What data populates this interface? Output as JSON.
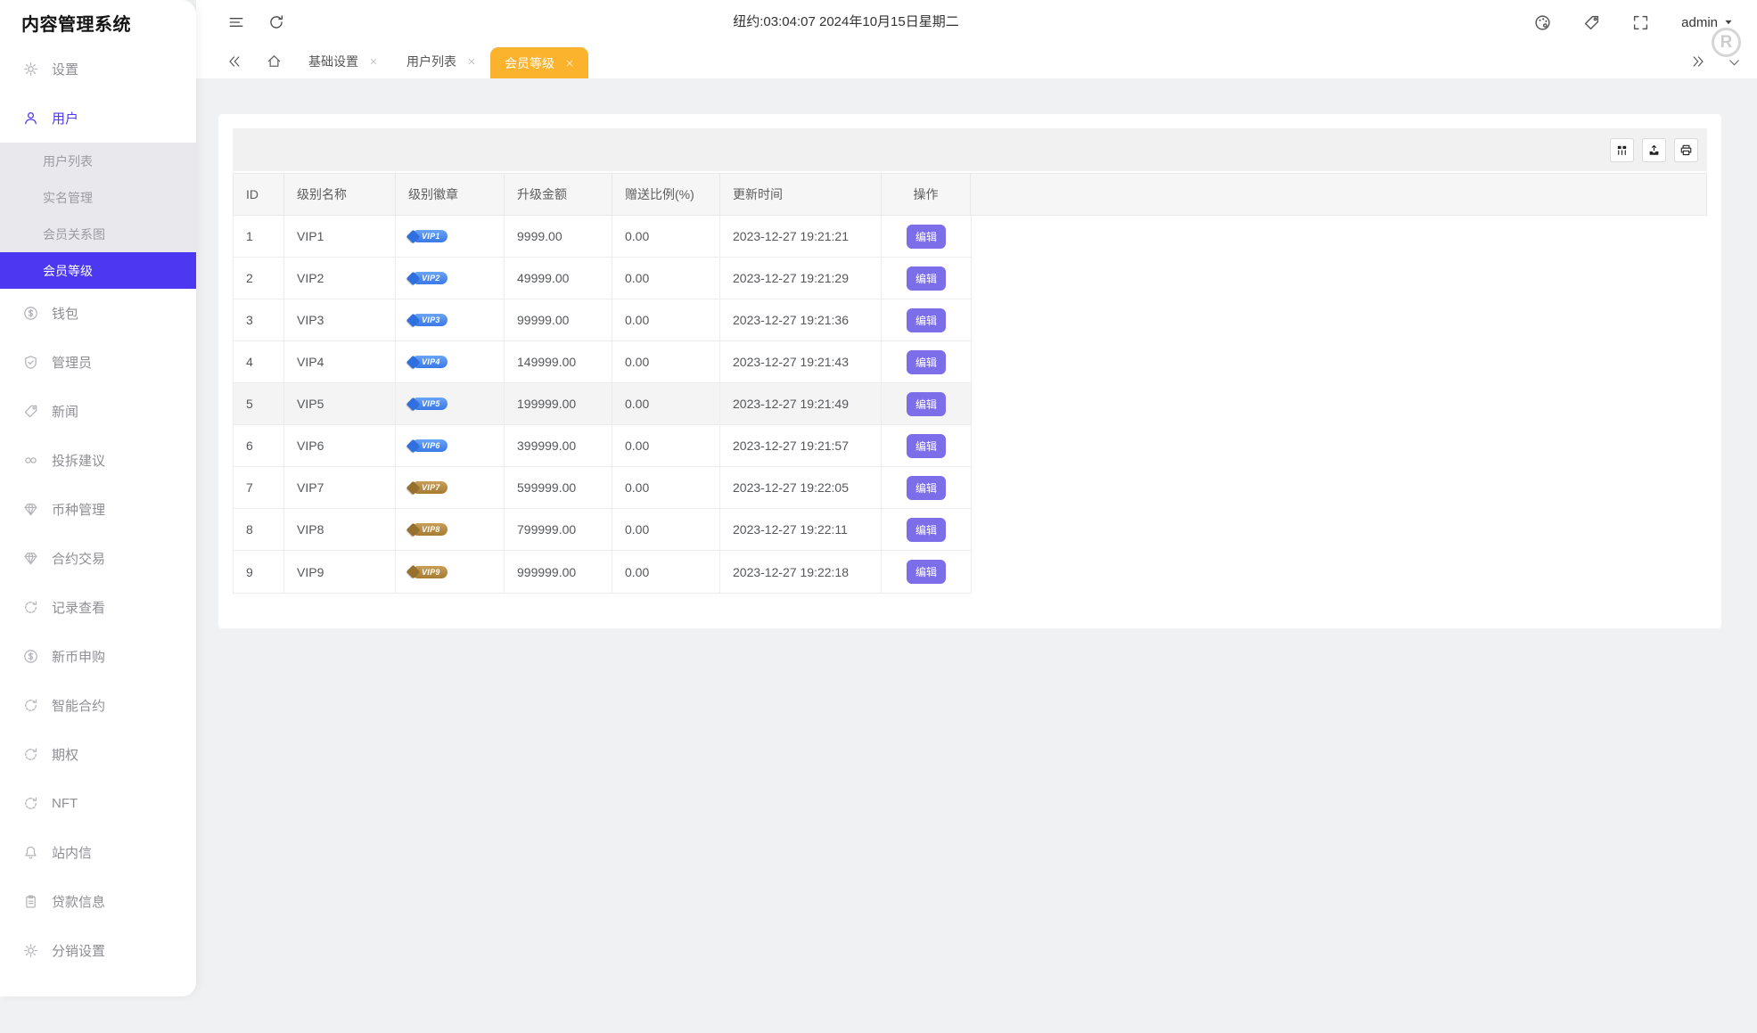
{
  "app": {
    "title": "内容管理系统"
  },
  "colors": {
    "accent": "#4b38f0",
    "tab_active": "#fbb32d",
    "edit_button": "#7c6ee9",
    "badge_blue": "#3a78e8",
    "badge_blue_light": "#68a4f6",
    "badge_blue_gem": "#2f6fe0",
    "badge_gold": "#a67c33",
    "badge_gold_light": "#c89e58",
    "badge_gold_gem": "#96702c"
  },
  "header": {
    "clock": "纽约:03:04:07 2024年10月15日星期二",
    "left_icons": [
      "menu-collapse",
      "refresh"
    ],
    "right_icons": [
      "palette",
      "price-tag",
      "fullscreen"
    ],
    "admin_label": "admin",
    "admin_caret_icon": "caret-down",
    "avatar_letter": "R"
  },
  "tabs": {
    "nav_left_icon": "chevrons-left",
    "home_icon": "home",
    "nav_right_icon": "chevrons-right",
    "menu_icon": "chevron-down",
    "close_icon": "close",
    "items": [
      {
        "label": "基础设置",
        "active": false
      },
      {
        "label": "用户列表",
        "active": false
      },
      {
        "label": "会员等级",
        "active": true
      }
    ]
  },
  "sidebar": {
    "sections": [
      {
        "type": "item",
        "icon": "gear",
        "label": "设置",
        "active": false
      },
      {
        "type": "item",
        "icon": "user",
        "label": "用户",
        "active": true
      },
      {
        "type": "submenu",
        "items": [
          {
            "label": "用户列表",
            "active": false
          },
          {
            "label": "实名管理",
            "active": false
          },
          {
            "label": "会员关系图",
            "active": false
          },
          {
            "label": "会员等级",
            "active": true
          }
        ]
      },
      {
        "type": "item",
        "icon": "coin",
        "label": "钱包",
        "active": false
      },
      {
        "type": "item",
        "icon": "shield-check",
        "label": "管理员",
        "active": false
      },
      {
        "type": "item",
        "icon": "tag",
        "label": "新闻",
        "active": false
      },
      {
        "type": "item",
        "icon": "link",
        "label": "投拆建议",
        "active": false
      },
      {
        "type": "item",
        "icon": "diamond",
        "label": "币种管理",
        "active": false
      },
      {
        "type": "item",
        "icon": "diamond",
        "label": "合约交易",
        "active": false
      },
      {
        "type": "item",
        "icon": "history",
        "label": "记录查看",
        "active": false
      },
      {
        "type": "item",
        "icon": "coin",
        "label": "新币申购",
        "active": false
      },
      {
        "type": "item",
        "icon": "history",
        "label": "智能合约",
        "active": false
      },
      {
        "type": "item",
        "icon": "history",
        "label": "期权",
        "active": false
      },
      {
        "type": "item",
        "icon": "history",
        "label": "NFT",
        "active": false
      },
      {
        "type": "item",
        "icon": "bell",
        "label": "站内信",
        "active": false
      },
      {
        "type": "item",
        "icon": "clipboard",
        "label": "贷款信息",
        "active": false
      },
      {
        "type": "item",
        "icon": "gear",
        "label": "分销设置",
        "active": false
      }
    ]
  },
  "toolbar": {
    "buttons": [
      "columns",
      "export",
      "print"
    ]
  },
  "table": {
    "headers": [
      "ID",
      "级别名称",
      "级别徽章",
      "升级金额",
      "赠送比例(%)",
      "更新时间",
      "操作"
    ],
    "edit_label": "编辑",
    "rows": [
      {
        "id": "1",
        "name": "VIP1",
        "badge": "blue",
        "amount": "9999.00",
        "ratio": "0.00",
        "updated": "2023-12-27 19:21:21",
        "highlight": false
      },
      {
        "id": "2",
        "name": "VIP2",
        "badge": "blue",
        "amount": "49999.00",
        "ratio": "0.00",
        "updated": "2023-12-27 19:21:29",
        "highlight": false
      },
      {
        "id": "3",
        "name": "VIP3",
        "badge": "blue",
        "amount": "99999.00",
        "ratio": "0.00",
        "updated": "2023-12-27 19:21:36",
        "highlight": false
      },
      {
        "id": "4",
        "name": "VIP4",
        "badge": "blue",
        "amount": "149999.00",
        "ratio": "0.00",
        "updated": "2023-12-27 19:21:43",
        "highlight": false
      },
      {
        "id": "5",
        "name": "VIP5",
        "badge": "blue",
        "amount": "199999.00",
        "ratio": "0.00",
        "updated": "2023-12-27 19:21:49",
        "highlight": true
      },
      {
        "id": "6",
        "name": "VIP6",
        "badge": "blue",
        "amount": "399999.00",
        "ratio": "0.00",
        "updated": "2023-12-27 19:21:57",
        "highlight": false
      },
      {
        "id": "7",
        "name": "VIP7",
        "badge": "gold",
        "amount": "599999.00",
        "ratio": "0.00",
        "updated": "2023-12-27 19:22:05",
        "highlight": false
      },
      {
        "id": "8",
        "name": "VIP8",
        "badge": "gold",
        "amount": "799999.00",
        "ratio": "0.00",
        "updated": "2023-12-27 19:22:11",
        "highlight": false
      },
      {
        "id": "9",
        "name": "VIP9",
        "badge": "gold",
        "amount": "999999.00",
        "ratio": "0.00",
        "updated": "2023-12-27 19:22:18",
        "highlight": false
      }
    ]
  }
}
